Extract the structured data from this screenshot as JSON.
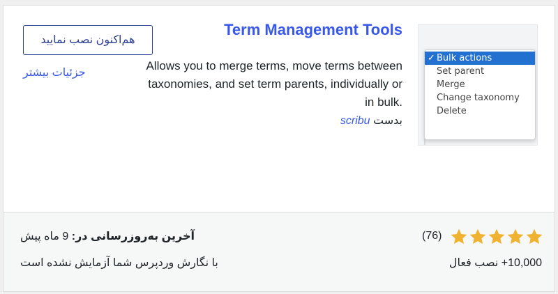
{
  "plugin": {
    "title": "Term Management Tools",
    "description": "Allows you to merge terms, move terms between taxonomies, and set term parents, individually or in bulk.",
    "author_prefix": "بدست",
    "author_name": "scribu"
  },
  "actions": {
    "install_label": "هم‌اکنون نصب نمایید",
    "more_details_label": "جزئیات بیشتر"
  },
  "thumbnail": {
    "options": [
      "Bulk actions",
      "Set parent",
      "Merge",
      "Change taxonomy",
      "Delete"
    ],
    "selected_index": 0,
    "check_mark": "✓"
  },
  "footer": {
    "rating_stars": 5,
    "rating_count": "(76)",
    "active_installs": "10,000+ نصب فعال",
    "last_updated_label": "آخرین به‌روزرسانی در:",
    "last_updated_value": "9 ماه پیش",
    "compatibility": "با نگارش وردپرس شما آزمایش نشده است"
  },
  "colors": {
    "accent": "#3858e9",
    "star": "#f0b331",
    "button_border": "#2c3e91"
  }
}
